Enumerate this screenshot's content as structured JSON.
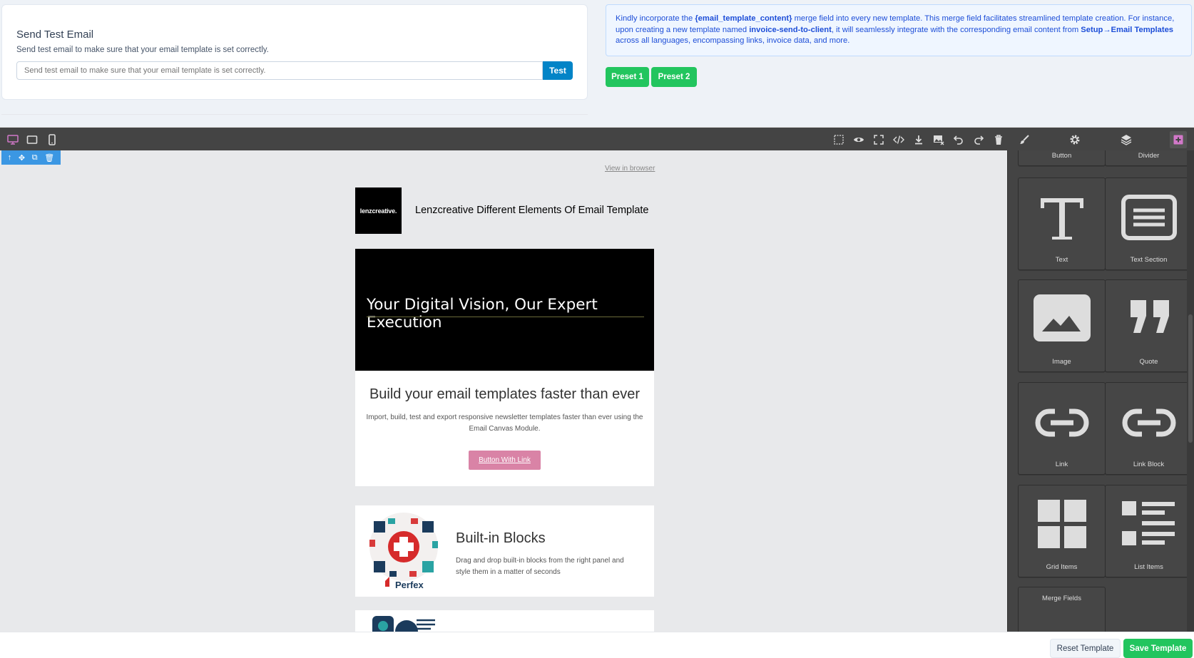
{
  "test_email": {
    "title": "Send Test Email",
    "description": "Send test email to make sure that your email template is set correctly.",
    "placeholder": "Send test email to make sure that your email template is set correctly.",
    "button": "Test"
  },
  "info": {
    "part1": "Kindly incorporate the ",
    "field": "{email_template_content}",
    "part2": " merge field into every new template. This merge field facilitates streamlined template creation. For instance, upon creating a new template named ",
    "template_name": "invoice-send-to-client",
    "part3": ", it will seamlessly integrate with the corresponding email content from ",
    "link": "Setup→Email Templates",
    "part4": " across all languages, encompassing links, invoice data, and more."
  },
  "presets": [
    "Preset 1",
    "Preset 2"
  ],
  "toolbar": {
    "devices": [
      "desktop-icon",
      "tablet-icon",
      "mobile-icon"
    ],
    "actions": [
      "select-area-icon",
      "eye-icon",
      "fullscreen-icon",
      "code-icon",
      "download-icon",
      "image-remove-icon",
      "undo-icon",
      "redo-icon",
      "trash-icon"
    ],
    "panels": [
      "brush-icon",
      "gear-icon",
      "layers-icon",
      "add-block-icon"
    ]
  },
  "blocks": {
    "top_labels": [
      "Button",
      "Divider"
    ],
    "items": [
      {
        "label": "Text",
        "icon": "text-icon"
      },
      {
        "label": "Text Section",
        "icon": "text-section-icon"
      },
      {
        "label": "Image",
        "icon": "image-icon"
      },
      {
        "label": "Quote",
        "icon": "quote-icon"
      },
      {
        "label": "Link",
        "icon": "link-icon"
      },
      {
        "label": "Link Block",
        "icon": "link-block-icon"
      },
      {
        "label": "Grid Items",
        "icon": "grid-items-icon"
      },
      {
        "label": "List Items",
        "icon": "list-items-icon"
      },
      {
        "label": "Merge Fields",
        "icon": "merge-fields-icon"
      }
    ]
  },
  "email": {
    "view_in_browser": "View in browser",
    "logo_text": "lenzcreative.",
    "header_title": "Lenzcreative Different Elements Of Email Template",
    "hero_title": "Your Digital Vision, Our Expert Execution",
    "build_title": "Build your email templates faster than ever",
    "build_text": "Import, build, test and export responsive newsletter templates faster than ever using the Email Canvas Module.",
    "button_text": "Button With Link",
    "blocks_title": "Built-in Blocks",
    "blocks_text": "Drag and drop built-in blocks from the right panel and style them in a matter of seconds",
    "thumb_label": "Perfex"
  },
  "footer": {
    "reset": "Reset Template",
    "save": "Save Template"
  },
  "colors": {
    "accent_blue": "#0284c7",
    "green": "#22c55e",
    "editor_dark": "#444444",
    "selection_blue": "#3b97e3",
    "active_pink": "#d278c9",
    "button_pink": "#d983a6"
  }
}
